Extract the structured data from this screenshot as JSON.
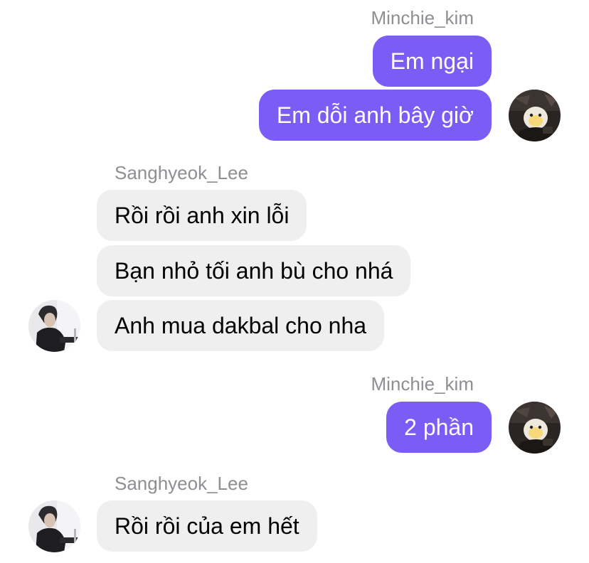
{
  "conversation": {
    "groups": [
      {
        "sender": "Minchie_kim",
        "messages": [
          "Em ngại",
          "Em dỗi anh bây giờ"
        ]
      },
      {
        "sender": "Sanghyeok_Lee",
        "messages": [
          "Rồi rồi anh xin lỗi",
          "Bạn nhỏ tối anh bù cho nhá",
          "Anh mua dakbal cho nha"
        ]
      },
      {
        "sender": "Minchie_kim",
        "messages": [
          "2 phần"
        ]
      },
      {
        "sender": "Sanghyeok_Lee",
        "messages": [
          "Rồi rồi của em hết"
        ]
      }
    ]
  },
  "colors": {
    "outgoing_bubble": "#7b5cf5",
    "incoming_bubble": "#efefef",
    "sender_name": "#8e8e93"
  },
  "icons": {
    "my_avatar": "avatar-photo-icon",
    "their_avatar": "avatar-photo-icon"
  }
}
